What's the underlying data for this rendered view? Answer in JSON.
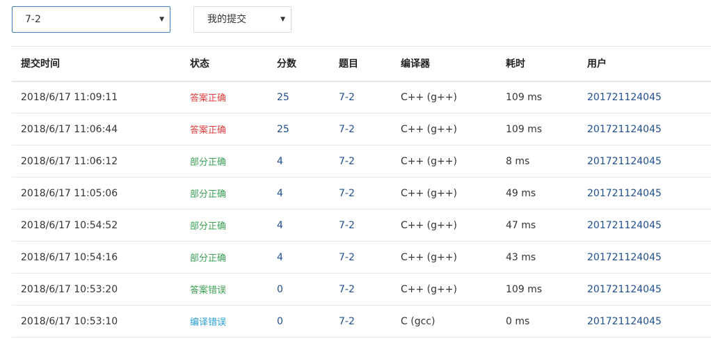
{
  "filters": {
    "problem": {
      "value": "7-2"
    },
    "scope": {
      "value": "我的提交"
    }
  },
  "table": {
    "headers": {
      "time": "提交时间",
      "status": "状态",
      "score": "分数",
      "problem": "题目",
      "compiler": "编译器",
      "cost": "耗时",
      "user": "用户"
    },
    "rows": [
      {
        "time": "2018/6/17 11:09:11",
        "status": "答案正确",
        "status_color": "#e03e3e",
        "score": "25",
        "problem": "7-2",
        "compiler": "C++ (g++)",
        "cost": "109 ms",
        "user": "201721124045"
      },
      {
        "time": "2018/6/17 11:06:44",
        "status": "答案正确",
        "status_color": "#e03e3e",
        "score": "25",
        "problem": "7-2",
        "compiler": "C++ (g++)",
        "cost": "109 ms",
        "user": "201721124045"
      },
      {
        "time": "2018/6/17 11:06:12",
        "status": "部分正确",
        "status_color": "#3aa153",
        "score": "4",
        "problem": "7-2",
        "compiler": "C++ (g++)",
        "cost": "8 ms",
        "user": "201721124045"
      },
      {
        "time": "2018/6/17 11:05:06",
        "status": "部分正确",
        "status_color": "#3aa153",
        "score": "4",
        "problem": "7-2",
        "compiler": "C++ (g++)",
        "cost": "49 ms",
        "user": "201721124045"
      },
      {
        "time": "2018/6/17 10:54:52",
        "status": "部分正确",
        "status_color": "#3aa153",
        "score": "4",
        "problem": "7-2",
        "compiler": "C++ (g++)",
        "cost": "47 ms",
        "user": "201721124045"
      },
      {
        "time": "2018/6/17 10:54:16",
        "status": "部分正确",
        "status_color": "#3aa153",
        "score": "4",
        "problem": "7-2",
        "compiler": "C++ (g++)",
        "cost": "43 ms",
        "user": "201721124045"
      },
      {
        "time": "2018/6/17 10:53:20",
        "status": "答案错误",
        "status_color": "#3aa153",
        "score": "0",
        "problem": "7-2",
        "compiler": "C++ (g++)",
        "cost": "109 ms",
        "user": "201721124045"
      },
      {
        "time": "2018/6/17 10:53:10",
        "status": "编译错误",
        "status_color": "#2a9fd6",
        "score": "0",
        "problem": "7-2",
        "compiler": "C (gcc)",
        "cost": "0 ms",
        "user": "201721124045"
      }
    ]
  }
}
